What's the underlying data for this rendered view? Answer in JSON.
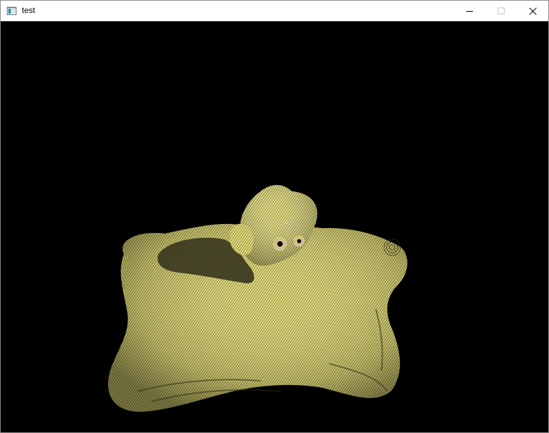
{
  "window": {
    "title": "test",
    "controls": {
      "minimize_icon": "minimize-icon",
      "maximize_icon": "maximize-icon",
      "close_icon": "close-icon"
    }
  },
  "viewport": {
    "background": "#000000",
    "content": "rendered-3d-blob-mesh",
    "colors": {
      "surface_light": "#f3ee8e",
      "surface_mid": "#cfc76a",
      "surface_dark": "#6f6a30",
      "shadow": "#3b3820",
      "eye_ring": "#c9a6c9",
      "eye_center": "#000000"
    }
  }
}
